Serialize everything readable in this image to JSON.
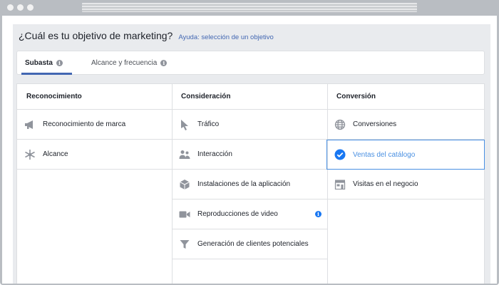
{
  "page": {
    "title": "¿Cuál es tu objetivo de marketing?",
    "help_link": "Ayuda: selección de un objetivo"
  },
  "tabs": [
    {
      "label": "Subasta",
      "selected": true
    },
    {
      "label": "Alcance y frecuencia",
      "selected": false
    }
  ],
  "columns": [
    {
      "header": "Reconocimiento",
      "items": [
        {
          "label": "Reconocimiento de marca",
          "icon": "megaphone-icon"
        },
        {
          "label": "Alcance",
          "icon": "snowflake-icon"
        }
      ]
    },
    {
      "header": "Consideración",
      "items": [
        {
          "label": "Tráfico",
          "icon": "cursor-icon"
        },
        {
          "label": "Interacción",
          "icon": "people-icon"
        },
        {
          "label": "Instalaciones de la aplicación",
          "icon": "cube-icon"
        },
        {
          "label": "Reproducciones de video",
          "icon": "video-camera-icon",
          "info": true
        },
        {
          "label": "Generación de clientes potenciales",
          "icon": "funnel-icon"
        }
      ]
    },
    {
      "header": "Conversión",
      "items": [
        {
          "label": "Conversiones",
          "icon": "globe-icon"
        },
        {
          "label": "Ventas del catálogo",
          "icon": "checkmark-circle-icon",
          "selected": true
        },
        {
          "label": "Visitas en el negocio",
          "icon": "store-icon"
        }
      ]
    }
  ],
  "colors": {
    "accent": "#4267b2",
    "selected": "#4a90e2",
    "icon_gray": "#90949c"
  }
}
